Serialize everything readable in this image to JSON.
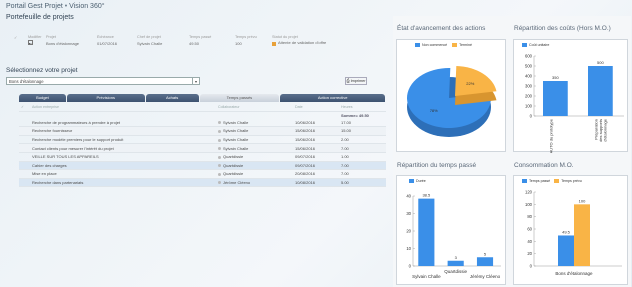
{
  "header": {
    "app": "Portail Gest Projet",
    "sep": "•",
    "page": "Vision 360°",
    "portfolio_title": "Portefeuille de projets"
  },
  "portfolio": {
    "columns": [
      "✓",
      "Modifier",
      "Projet",
      "Échéance",
      "Chef de projet",
      "Temps passé",
      "Temps prévu",
      "Statut du projet"
    ],
    "row": {
      "project": "Bons d'étalonnage",
      "deadline": "01/07/2016",
      "manager": "Sylvain Challe",
      "time_spent": "49.50",
      "time_planned": "100",
      "status": "Attente de validation d'offre"
    }
  },
  "select": {
    "title": "Sélectionnez votre projet",
    "value": "Bons d'étalonnage",
    "print": "Imprimer"
  },
  "tabs": [
    "Budget",
    "Prévisions",
    "Achats",
    "Temps passés",
    "Action corrective"
  ],
  "tasks": {
    "headers": [
      "✓",
      "Action entreprise",
      "Collaborateur",
      "Date",
      "Heures"
    ],
    "total_label": "Somme= 49.50",
    "rows": [
      {
        "action": "Recherche de programmateurs à prendre à projet",
        "person": "Sylvain Challe",
        "date": "10/06/2016",
        "hours": "17.00"
      },
      {
        "action": "Recherche fournisseur",
        "person": "Sylvain Challe",
        "date": "15/06/2016",
        "hours": "15.00"
      },
      {
        "action": "Recherche modèle premiers pour le support produit",
        "person": "Sylvain Challe",
        "date": "15/06/2016",
        "hours": "2.00"
      },
      {
        "action": "Contact clients pour mesurer l'intérêt du projet",
        "person": "Sylvain Challe",
        "date": "15/06/2016",
        "hours": "7.00"
      },
      {
        "action": "VEILLE SUR TOUS LES APPAREILS",
        "person": "Quartdissie",
        "date": "09/07/2016",
        "hours": "1.00"
      },
      {
        "action": "Cahier des charges",
        "person": "Quartdissie",
        "date": "09/07/2016",
        "hours": "7.00"
      },
      {
        "action": "Mise en place",
        "person": "Quartdissie",
        "date": "20/08/2016",
        "hours": "7.00"
      },
      {
        "action": "Recherche dans partenariats",
        "person": "Jérôme Cléeno",
        "date": "10/08/2016",
        "hours": "5.00"
      }
    ]
  },
  "charts": {
    "colors": {
      "blue": "#3a8fe8",
      "orange": "#f9b446",
      "axis": "#999999"
    },
    "pie": {
      "title": "État d'avancement des actions",
      "legend": [
        "Non commencé",
        "Terminé"
      ],
      "values": [
        {
          "label": "Non commencé",
          "pct": 78,
          "text": "78%"
        },
        {
          "label": "Terminé",
          "pct": 22,
          "text": "22%"
        }
      ]
    },
    "costs": {
      "title": "Répartition des coûts (Hors M.O.)",
      "legend": "Coût unitaire",
      "yticks": [
        "600",
        "500",
        "400",
        "300",
        "200",
        "100",
        "0"
      ],
      "ymax": 600,
      "bars": [
        {
          "category": "AUTO du prototype",
          "value": 350,
          "label": "350"
        },
        {
          "category": "Préparation des supports d'étalonnage",
          "value": 500,
          "label": "500"
        }
      ]
    },
    "time": {
      "title": "Répartition du temps passé",
      "legend": "Durée",
      "yticks": [
        "40",
        "30",
        "20",
        "10",
        "0"
      ],
      "ymax": 40,
      "bars": [
        {
          "category": "Sylvain Challe",
          "value": 38.5,
          "label": "38.5"
        },
        {
          "category": "Quartdissie",
          "value": 3,
          "label": "3"
        },
        {
          "category": "Jérémy Cléeno",
          "value": 5,
          "label": "5"
        }
      ]
    },
    "mo": {
      "title": "Consommation M.O.",
      "legend": [
        "Temps passé",
        "Temps prévu"
      ],
      "yticks": [
        "120",
        "100",
        "80",
        "60",
        "40",
        "20",
        "0"
      ],
      "ymax": 120,
      "category": "Bons d'étalonnage",
      "values": [
        {
          "name": "Temps passé",
          "value": 49.5,
          "label": "49.5"
        },
        {
          "name": "Temps prévu",
          "value": 100,
          "label": "100"
        }
      ]
    }
  },
  "chart_data": [
    {
      "type": "pie",
      "title": "État d'avancement des actions",
      "categories": [
        "Non commencé",
        "Terminé"
      ],
      "values": [
        78,
        22
      ]
    },
    {
      "type": "bar",
      "title": "Répartition des coûts (Hors M.O.)",
      "categories": [
        "AUTO du prototype",
        "Préparation des supports d'étalonnage"
      ],
      "series": [
        {
          "name": "Coût unitaire",
          "values": [
            350,
            500
          ]
        }
      ],
      "ylim": [
        0,
        600
      ]
    },
    {
      "type": "bar",
      "title": "Répartition du temps passé",
      "categories": [
        "Sylvain Challe",
        "Quartdissie",
        "Jérémy Cléeno"
      ],
      "series": [
        {
          "name": "Durée",
          "values": [
            38.5,
            3,
            5
          ]
        }
      ],
      "ylim": [
        0,
        40
      ]
    },
    {
      "type": "bar",
      "title": "Consommation M.O.",
      "categories": [
        "Bons d'étalonnage"
      ],
      "series": [
        {
          "name": "Temps passé",
          "values": [
            49.5
          ]
        },
        {
          "name": "Temps prévu",
          "values": [
            100
          ]
        }
      ],
      "ylim": [
        0,
        120
      ]
    }
  ]
}
